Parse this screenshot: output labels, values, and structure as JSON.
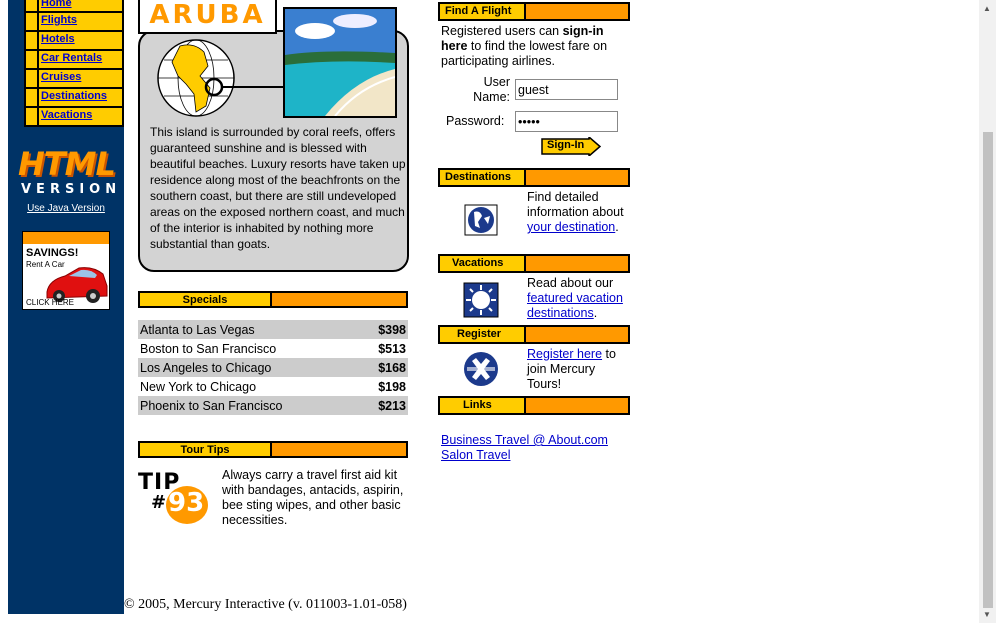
{
  "nav": {
    "items": [
      {
        "label": "Home"
      },
      {
        "label": "Flights"
      },
      {
        "label": "Hotels"
      },
      {
        "label": "Car Rentals"
      },
      {
        "label": "Cruises"
      },
      {
        "label": "Destinations"
      },
      {
        "label": "Vacations"
      }
    ],
    "html_logo": "HTML",
    "version_word": "VERSION",
    "use_java": "Use Java Version"
  },
  "ad": {
    "savings": "SAVINGS!",
    "rent": "Rent A Car",
    "click": "CLICK HERE"
  },
  "feature": {
    "title": "ARUBA",
    "text": "This island is surrounded by coral reefs, offers guaranteed sunshine and is blessed with beautiful beaches. Luxury resorts have taken up residence along most of the beachfronts on the southern coast, but there are still undeveloped areas on the exposed northern coast, and much of the interior is inhabited by nothing more substantial than goats."
  },
  "specials": {
    "label": "Specials",
    "rows": [
      {
        "route": "Atlanta to Las Vegas",
        "price": "$398"
      },
      {
        "route": "Boston to San Francisco",
        "price": "$513"
      },
      {
        "route": "Los Angeles to Chicago",
        "price": "$168"
      },
      {
        "route": "New York to Chicago",
        "price": "$198"
      },
      {
        "route": "Phoenix to San Francisco",
        "price": "$213"
      }
    ]
  },
  "tour_tips": {
    "label": "Tour Tips",
    "tip_word": "TIP",
    "tip_hash": "#",
    "tip_number": "93",
    "text": "Always carry a travel first aid kit with bandages, antacids, aspirin, bee sting wipes, and other basic necessities."
  },
  "find_flight": {
    "label": "Find A Flight",
    "intro_1": "Registered users can ",
    "intro_bold": "sign-in here",
    "intro_2": " to find the lowest fare on participating airlines.",
    "user_label": "User Name:",
    "user_value": "guest",
    "pass_label": "Password:",
    "pass_value": "•••••",
    "signin": "Sign-In"
  },
  "destinations": {
    "label": "Destinations",
    "pre": "Find detailed information about ",
    "link": "your destination",
    "post": "."
  },
  "vacations": {
    "label": "Vacations",
    "pre": "Read about our ",
    "link": "featured vacation destinations",
    "post": "."
  },
  "register": {
    "label": "Register",
    "link": "Register here",
    "post": " to join Mercury Tours!"
  },
  "links": {
    "label": "Links",
    "items": [
      "Business Travel @ About.com",
      "Salon Travel"
    ]
  },
  "footer": {
    "copyright": "© 2005, Mercury Interactive (v. 011003-1.01-058)"
  },
  "colors": {
    "navy": "#003366",
    "yellow": "#ffcc00",
    "orange": "#ff9900",
    "link": "#0000cc"
  }
}
